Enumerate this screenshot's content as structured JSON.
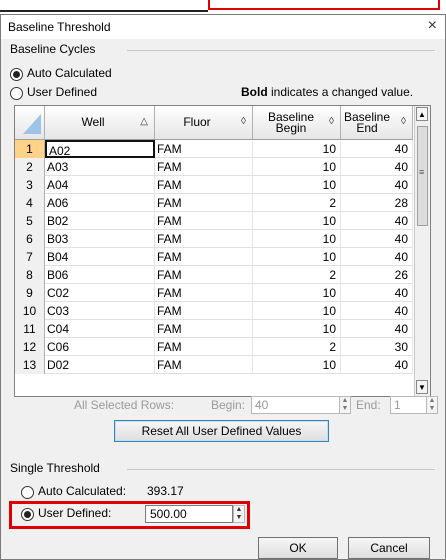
{
  "window": {
    "title": "Baseline Threshold",
    "close": "×"
  },
  "baseline_cycles": {
    "group_label": "Baseline Cycles",
    "auto_label": "Auto Calculated",
    "user_label": "User Defined",
    "note_bold": "Bold",
    "note_rest": " indicates a changed value."
  },
  "table": {
    "headers": {
      "well": "Well",
      "fluor": "Fluor",
      "begin": "Baseline Begin",
      "end": "Baseline End"
    },
    "rows": [
      {
        "n": "1",
        "well": "A02",
        "fluor": "FAM",
        "begin": "10",
        "end": "40"
      },
      {
        "n": "2",
        "well": "A03",
        "fluor": "FAM",
        "begin": "10",
        "end": "40"
      },
      {
        "n": "3",
        "well": "A04",
        "fluor": "FAM",
        "begin": "10",
        "end": "40"
      },
      {
        "n": "4",
        "well": "A06",
        "fluor": "FAM",
        "begin": "2",
        "end": "28"
      },
      {
        "n": "5",
        "well": "B02",
        "fluor": "FAM",
        "begin": "10",
        "end": "40"
      },
      {
        "n": "6",
        "well": "B03",
        "fluor": "FAM",
        "begin": "10",
        "end": "40"
      },
      {
        "n": "7",
        "well": "B04",
        "fluor": "FAM",
        "begin": "10",
        "end": "40"
      },
      {
        "n": "8",
        "well": "B06",
        "fluor": "FAM",
        "begin": "2",
        "end": "26"
      },
      {
        "n": "9",
        "well": "C02",
        "fluor": "FAM",
        "begin": "10",
        "end": "40"
      },
      {
        "n": "10",
        "well": "C03",
        "fluor": "FAM",
        "begin": "10",
        "end": "40"
      },
      {
        "n": "11",
        "well": "C04",
        "fluor": "FAM",
        "begin": "10",
        "end": "40"
      },
      {
        "n": "12",
        "well": "C06",
        "fluor": "FAM",
        "begin": "2",
        "end": "30"
      },
      {
        "n": "13",
        "well": "D02",
        "fluor": "FAM",
        "begin": "10",
        "end": "40"
      }
    ]
  },
  "selected_rows": {
    "label": "All Selected Rows:",
    "begin_label": "Begin:",
    "begin_value": "40",
    "end_label": "End:",
    "end_value": "1"
  },
  "reset_button": "Reset All User Defined Values",
  "single_threshold": {
    "group_label": "Single Threshold",
    "auto_label": "Auto Calculated:",
    "auto_value": "393.17",
    "user_label": "User Defined:",
    "user_value": "500.00"
  },
  "buttons": {
    "ok": "OK",
    "cancel": "Cancel"
  }
}
